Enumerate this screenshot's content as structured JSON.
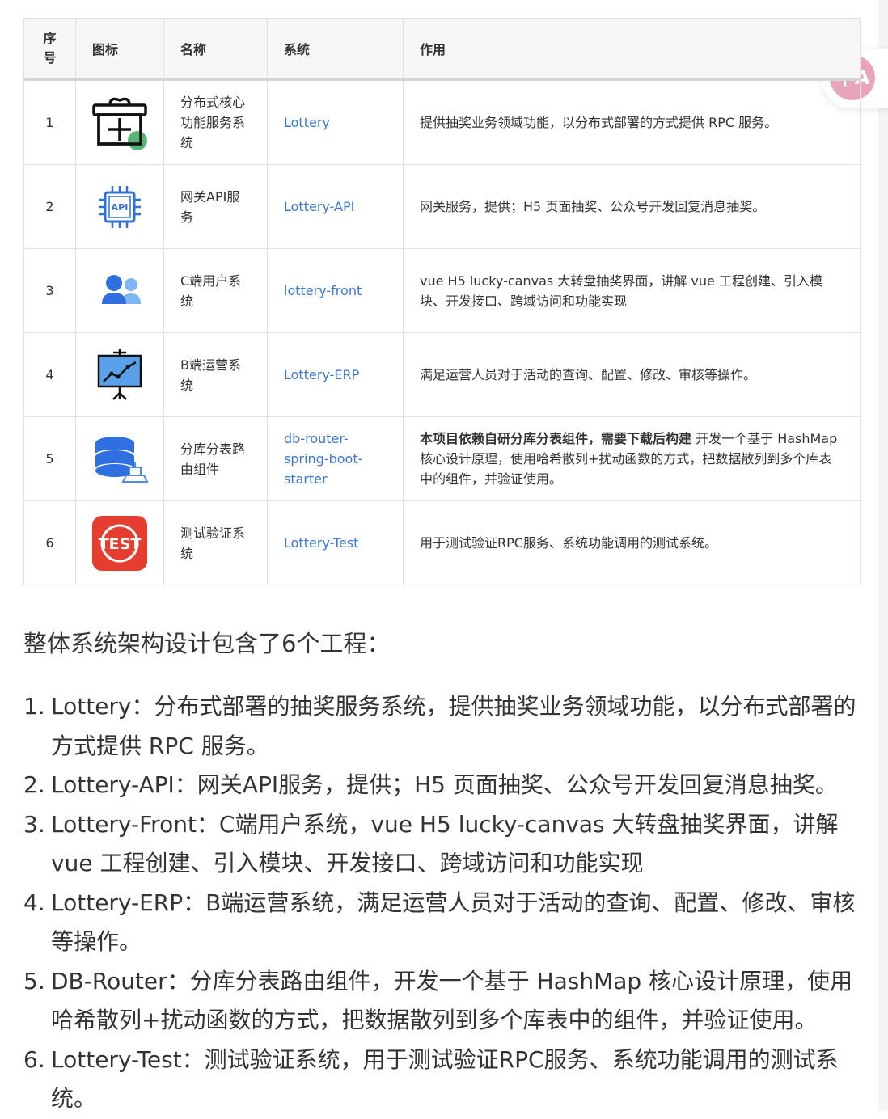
{
  "table": {
    "headers": [
      "序号",
      "图标",
      "名称",
      "系统",
      "作用"
    ],
    "rows": [
      {
        "num": "1",
        "icon": "gift-icon",
        "name": "分布式核心功能服务系统",
        "system": "Lottery",
        "role": "提供抽奖业务领域功能，以分布式部署的方式提供 RPC 服务。"
      },
      {
        "num": "2",
        "icon": "api-chip-icon",
        "name": "网关API服务",
        "system": "Lottery-API",
        "role": "网关服务，提供；H5 页面抽奖、公众号开发回复消息抽奖。"
      },
      {
        "num": "3",
        "icon": "users-icon",
        "name": "C端用户系统",
        "system": "lottery-front",
        "role": "vue H5 lucky-canvas 大转盘抽奖界面，讲解 vue 工程创建、引入模块、开发接口、跨域访问和功能实现"
      },
      {
        "num": "4",
        "icon": "presentation-chart-icon",
        "name": "B端运营系统",
        "system": "Lottery-ERP",
        "role": "满足运营人员对于活动的查询、配置、修改、审核等操作。"
      },
      {
        "num": "5",
        "icon": "database-icon",
        "name": "分库分表路由组件",
        "system": "db-router-spring-boot-starter",
        "role_bold": "本项目依赖自研分库分表组件，需要下载后构建",
        "role": " 开发一个基于 HashMap 核心设计原理，使用哈希散列+扰动函数的方式，把数据散列到多个库表中的组件，并验证使用。"
      },
      {
        "num": "6",
        "icon": "test-badge-icon",
        "icon_text": "TEST",
        "name": "测试验证系统",
        "system": "Lottery-Test",
        "role": "用于测试验证RPC服务、系统功能调用的测试系统。"
      }
    ]
  },
  "intro": "整体系统架构设计包含了6个工程：",
  "projects": [
    {
      "idx": "1.",
      "text": "Lottery：分布式部署的抽奖服务系统，提供抽奖业务领域功能，以分布式部署的方式提供 RPC 服务。"
    },
    {
      "idx": "2.",
      "text": "Lottery-API：网关API服务，提供；H5 页面抽奖、公众号开发回复消息抽奖。"
    },
    {
      "idx": "3.",
      "text": "Lottery-Front：C端用户系统，vue H5 lucky-canvas 大转盘抽奖界面，讲解 vue 工程创建、引入模块、开发接口、跨域访问和功能实现"
    },
    {
      "idx": "4.",
      "text": "Lottery-ERP：B端运营系统，满足运营人员对于活动的查询、配置、修改、审核等操作。"
    },
    {
      "idx": "5.",
      "text": "DB-Router：分库分表路由组件，开发一个基于 HashMap 核心设计原理，使用哈希散列+扰动函数的方式，把数据散列到多个库表中的组件，并验证使用。"
    },
    {
      "idx": "6.",
      "text": "Lottery-Test：测试验证系统，用于测试验证RPC服务、系统功能调用的测试系统。"
    }
  ],
  "translate_button": {
    "icon": "translate-icon",
    "glyph": "中A"
  },
  "colors": {
    "link": "#3a76d8",
    "border": "#dfe2e5",
    "header_bg": "#f6f6f6",
    "test_red": "#e53d30",
    "translate_pink": "#e8a4b8"
  }
}
